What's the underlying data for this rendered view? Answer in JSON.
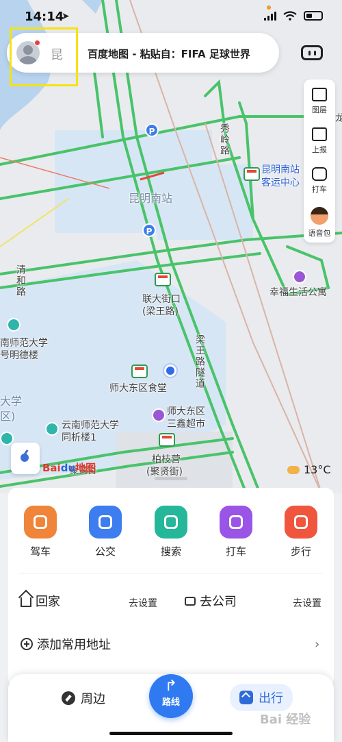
{
  "status": {
    "time": "14:14"
  },
  "search": {
    "city": "昆",
    "clipboard": "百度地图 - 粘贴自：FIFA 足球世界"
  },
  "map": {
    "labels": {
      "station": "昆明南站",
      "qinghe_road": "清和路",
      "xiuling_road": "秀岭路",
      "bus_center_1": "昆明南站",
      "bus_center_2": "客运中心",
      "happy_apartment": "幸福生活公寓",
      "lianda_1": "联大街口",
      "lianda_2": "(梁王路)",
      "liangwang_tunnel": "梁王路隧道",
      "canteen": "师大东区食堂",
      "supermarket_1": "师大东区",
      "supermarket_2": "三鑫超市",
      "university_1": "南师范大学",
      "university_2": "号明德楼",
      "university_3": "大学",
      "university_4": "区)",
      "tongke": "云南师范大学",
      "tongke_2": "同析楼1",
      "baizhiying_1": "柏枝营",
      "baizhiying_2": "(聚贤街)",
      "juxian_street": "聚贤街",
      "partial_right": "龙"
    },
    "logo_text": "Bai",
    "logo_mark": "du",
    "logo_suffix": "地图",
    "weather": "13°C"
  },
  "tools": [
    {
      "label": "图层",
      "icon": "layers-icon"
    },
    {
      "label": "上报",
      "icon": "report-icon"
    },
    {
      "label": "打车",
      "icon": "taxi-icon"
    },
    {
      "label": "语音包",
      "icon": "voice-pack-icon"
    }
  ],
  "quick": [
    {
      "label": "驾车",
      "color": "#f0853a"
    },
    {
      "label": "公交",
      "color": "#3d7df0"
    },
    {
      "label": "搜索",
      "color": "#25b79a"
    },
    {
      "label": "打车",
      "color": "#9a55e6"
    },
    {
      "label": "步行",
      "color": "#f0553d"
    }
  ],
  "addresses": {
    "home": "回家",
    "home_set": "去设置",
    "company": "去公司",
    "company_set": "去设置",
    "add": "添加常用地址"
  },
  "nav": {
    "nearby": "周边",
    "route": "路线",
    "go": "出行"
  },
  "watermark": "Bai 经验"
}
